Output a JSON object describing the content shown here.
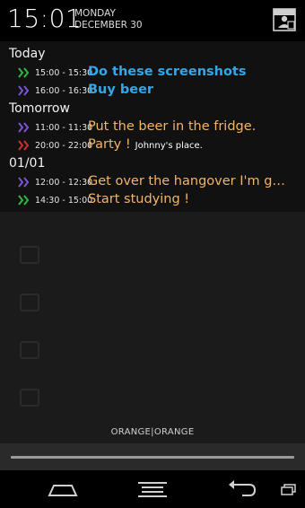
{
  "status": {
    "time": "15:01",
    "day": "MONDAY",
    "date": "DECEMBER 30",
    "settings_icon": "settings-icon"
  },
  "agenda": {
    "sections": [
      {
        "label": "Today",
        "events": [
          {
            "time": "15:00 - 15:30",
            "title": "Do these screenshots",
            "sub": "",
            "chevron_color": "#2dbb3c",
            "title_style": "blue"
          },
          {
            "time": "16:00 - 16:30",
            "title": "Buy beer",
            "sub": "",
            "chevron_color": "#7b55d6",
            "title_style": "blue"
          }
        ]
      },
      {
        "label": "Tomorrow",
        "events": [
          {
            "time": "11:00 - 11:30",
            "title": "Put the beer in the fridge.",
            "sub": "",
            "chevron_color": "#7b55d6",
            "title_style": "orange"
          },
          {
            "time": "20:00 - 22:00",
            "title": "Party !",
            "sub": "Johnny's place.",
            "chevron_color": "#d0312d",
            "title_style": "orange"
          }
        ]
      },
      {
        "label": "01/01",
        "events": [
          {
            "time": "12:00 - 12:30",
            "title": "Get over the hangover I'm gonna have",
            "sub": "",
            "chevron_color": "#7b55d6",
            "title_style": "orange"
          },
          {
            "time": "14:30 - 15:00",
            "title": "Start studying !",
            "sub": "",
            "chevron_color": "#2dbb3c",
            "title_style": "orange"
          }
        ]
      }
    ]
  },
  "background_items": [
    {
      "label": ""
    },
    {
      "label": ""
    },
    {
      "label": ""
    },
    {
      "label": ""
    }
  ],
  "footer": {
    "theme_label": "ORANGE|ORANGE"
  },
  "colors": {
    "accent_blue": "#33a7e8",
    "accent_orange": "#f4b466",
    "green": "#2dbb3c",
    "purple": "#7b55d6",
    "red": "#d0312d"
  }
}
